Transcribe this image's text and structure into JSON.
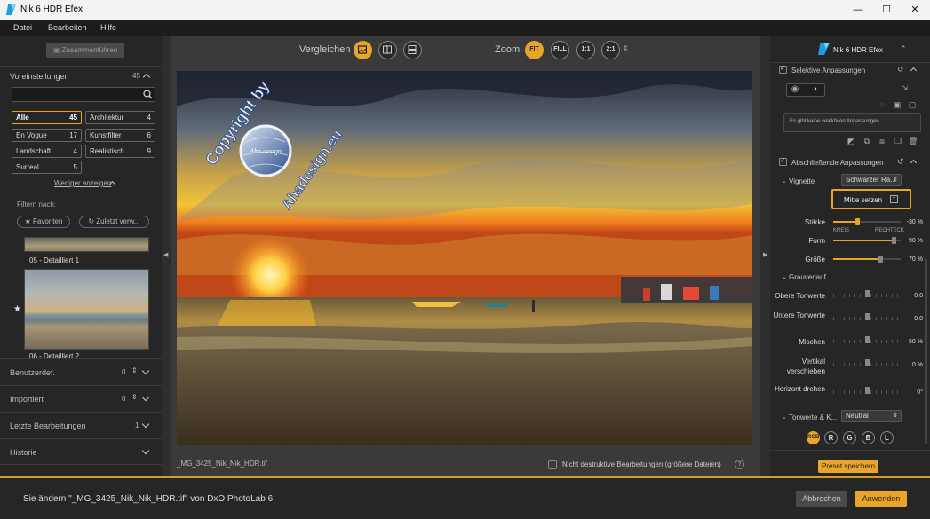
{
  "window": {
    "title": "Nik 6 HDR Efex",
    "minimize": "—",
    "maximize": "☐",
    "close": "✕"
  },
  "menu": [
    "Datei",
    "Bearbeiten",
    "Hilfe"
  ],
  "left": {
    "merge_button": "Zusammenführen",
    "presets_title": "Voreinstellungen",
    "presets_count": "45",
    "search_placeholder": "",
    "categories": [
      {
        "label": "Alle",
        "count": "45",
        "selected": true
      },
      {
        "label": "Architektur",
        "count": "4"
      },
      {
        "label": "En Vogue",
        "count": "17"
      },
      {
        "label": "Kunstfilter",
        "count": "6"
      },
      {
        "label": "Landschaft",
        "count": "4"
      },
      {
        "label": "Realistisch",
        "count": "9"
      },
      {
        "label": "Surreal",
        "count": "5"
      }
    ],
    "show_less": "Weniger anzeigen",
    "filter_label": "Filtern nach:",
    "filter_favorites": "★ Favoriten",
    "filter_recent": "↻ Zuletzt verw...",
    "thumbs": [
      {
        "label": "05 - Detailliert 1"
      },
      {
        "label": "06 - Detailliert 2"
      }
    ],
    "rows": [
      {
        "label": "Benutzerdef.",
        "count": "0"
      },
      {
        "label": "Importiert",
        "count": "0"
      },
      {
        "label": "Letzte Bearbeitungen",
        "count": "1"
      },
      {
        "label": "Historie",
        "count": ""
      }
    ]
  },
  "center": {
    "compare_label": "Vergleichen",
    "zoom_label": "Zoom",
    "zoom_buttons": [
      "FIT",
      "FILL",
      "1:1",
      "2:1"
    ],
    "filename": "_MG_3425_Nik_Nik_HDR.tif",
    "nondestructive_label": "Nicht destruktive Bearbeitungen (größere Dateien)",
    "help_icon": "?",
    "watermark_top": "Copyright by",
    "watermark_bottom": "Ahadesign.eu",
    "watermark_center": "Aha design"
  },
  "right": {
    "app_name": "Nik 6 HDR Efex",
    "selective_title": "Selektive Anpassungen",
    "selective_empty": "Es gibt keine selektiven Anpassungen",
    "final_title": "Abschließende Anpassungen",
    "vignette_label": "Vignette",
    "vignette_value": "Schwarzer Ra...",
    "center_button": "Mitte setzen",
    "sliders_top": [
      {
        "label": "Stärke",
        "value": "-30 %",
        "level": 0.35
      },
      {
        "label": "Form",
        "value": "90 %",
        "level": 0.9
      },
      {
        "label": "Größe",
        "value": "70 %",
        "level": 0.7
      }
    ],
    "form_min_label": "KREIS",
    "form_max_label": "RECHTECK",
    "gradient_title": "Grauverlauf",
    "sliders_grad": [
      {
        "label": "Obere Tonwerte",
        "value": "0.0"
      },
      {
        "label": "Untere Tonwerte",
        "value": "0.0"
      },
      {
        "label": "Mischen",
        "value": "50 %"
      },
      {
        "label": "Vertikal verschieben",
        "value": "0 %"
      },
      {
        "label": "Horizont drehen",
        "value": "0°"
      }
    ],
    "tone_label": "Tonwerte & K...",
    "tone_value": "Neutral",
    "channels": [
      "RGB",
      "R",
      "G",
      "B",
      "L"
    ],
    "save_preset": "Preset speichern"
  },
  "footer": {
    "message": "Sie ändern \"_MG_3425_Nik_Nik_HDR.tif\" von DxO PhotoLab 6",
    "cancel": "Abbrechen",
    "apply": "Anwenden"
  },
  "colors": {
    "accent": "#e8a52a"
  }
}
